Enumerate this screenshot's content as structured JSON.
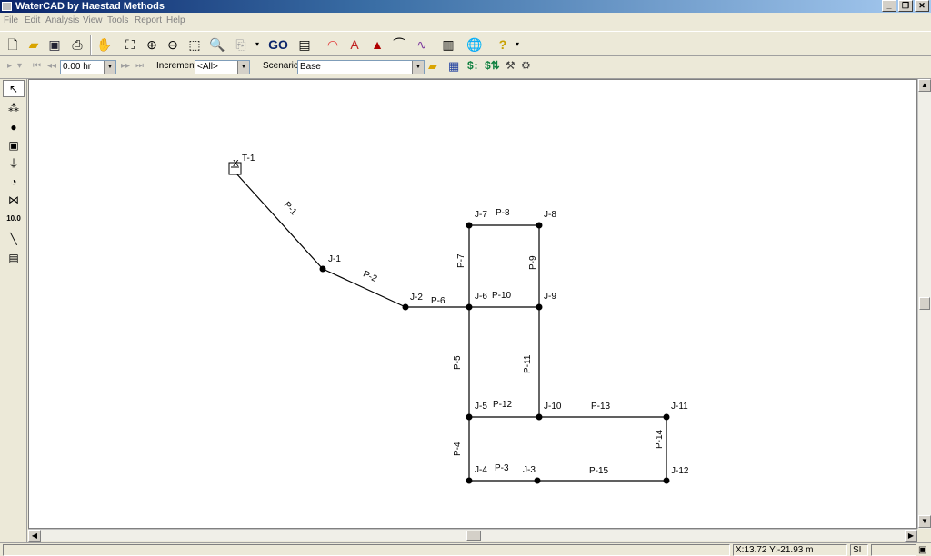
{
  "window": {
    "title": "WaterCAD by Haestad Methods"
  },
  "menu": [
    "File",
    "Edit",
    "Analysis",
    "View",
    "Tools",
    "Report",
    "Help"
  ],
  "toolbar": {
    "go_label": "GO"
  },
  "controls": {
    "time_value": "0.00 hr",
    "increment_label": "Increment:",
    "increment_value": "<All>",
    "scenario_label": "Scenario:",
    "scenario_value": "Base"
  },
  "network": {
    "tank": {
      "label": "T-1"
    },
    "nodes": [
      {
        "id": "J-1"
      },
      {
        "id": "J-2"
      },
      {
        "id": "J-3"
      },
      {
        "id": "J-4"
      },
      {
        "id": "J-5"
      },
      {
        "id": "J-6"
      },
      {
        "id": "J-7"
      },
      {
        "id": "J-8"
      },
      {
        "id": "J-9"
      },
      {
        "id": "J-10"
      },
      {
        "id": "J-11"
      },
      {
        "id": "J-12"
      }
    ],
    "pipes": [
      {
        "id": "P-1"
      },
      {
        "id": "P-2"
      },
      {
        "id": "P-3"
      },
      {
        "id": "P-4"
      },
      {
        "id": "P-5"
      },
      {
        "id": "P-6"
      },
      {
        "id": "P-7"
      },
      {
        "id": "P-8"
      },
      {
        "id": "P-9"
      },
      {
        "id": "P-10"
      },
      {
        "id": "P-11"
      },
      {
        "id": "P-12"
      },
      {
        "id": "P-13"
      },
      {
        "id": "P-14"
      },
      {
        "id": "P-15"
      }
    ]
  },
  "status": {
    "coords": "X:13.72  Y:-21.93 m",
    "units": "SI"
  }
}
